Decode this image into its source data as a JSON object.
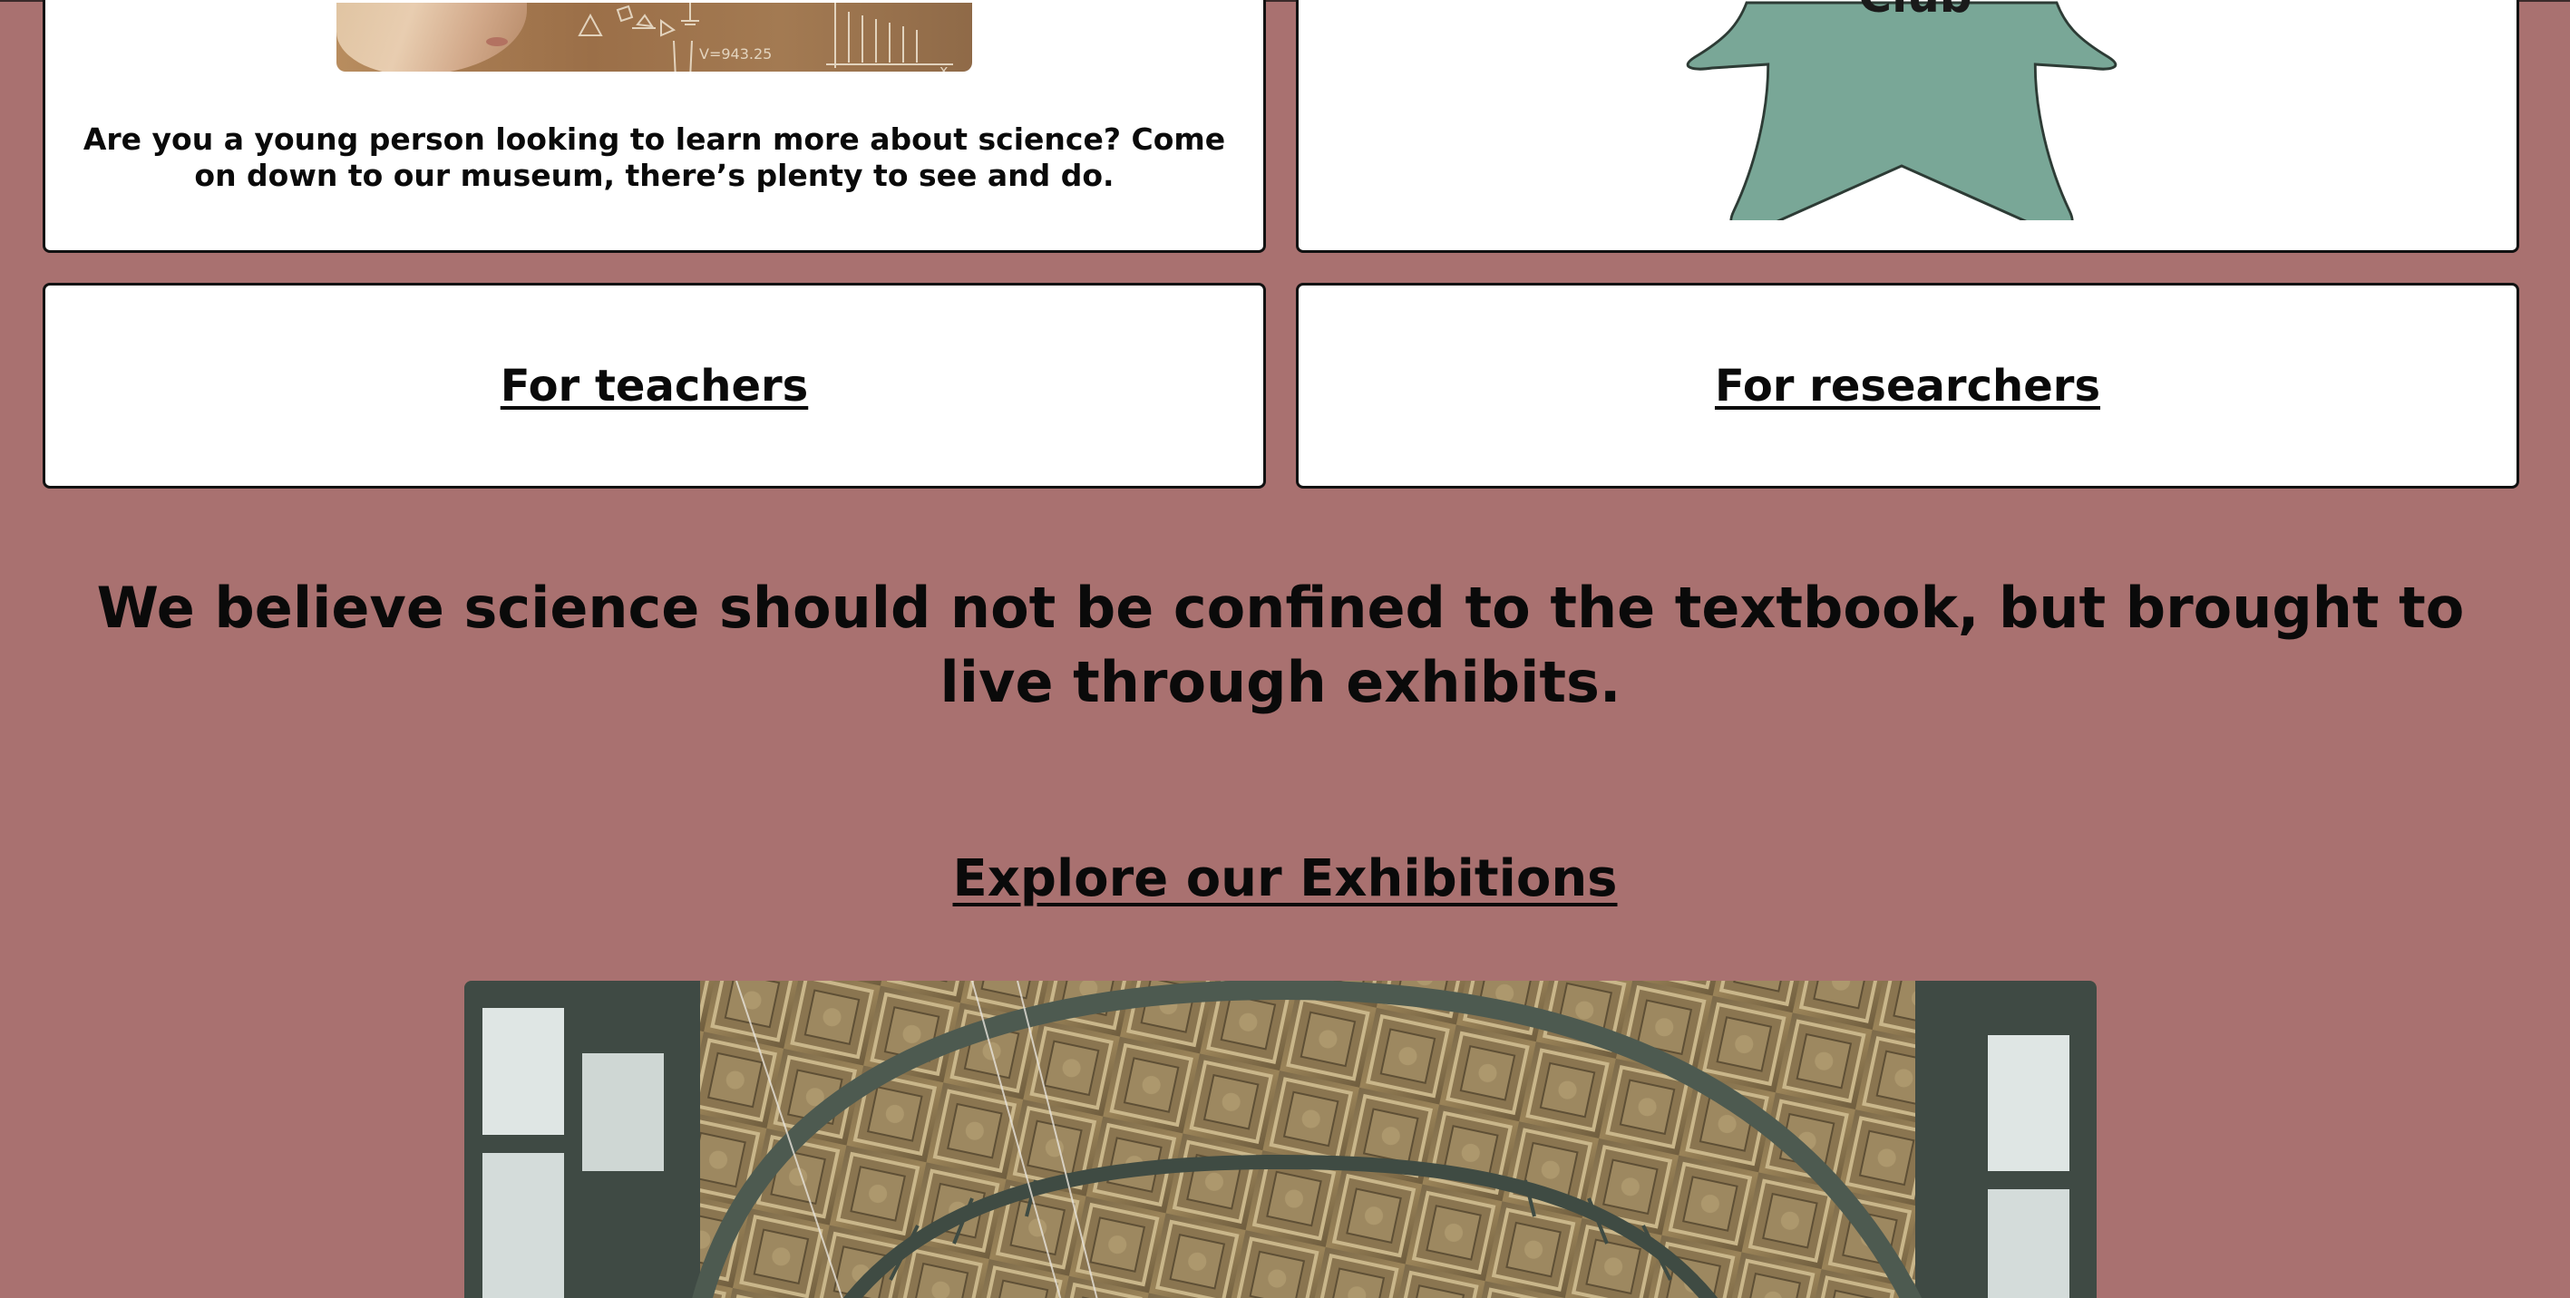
{
  "cards": {
    "young": {
      "text": "Are you a young person looking to learn more about science? Come on down to our museum, there’s plenty to see and do.",
      "photo_alt": "young-person-photo"
    },
    "club": {
      "star_text": "Club",
      "star_color": "#79a797"
    },
    "teachers": {
      "link_label": "For teachers"
    },
    "researchers": {
      "link_label": "For researchers"
    }
  },
  "belief_statement": "We believe science should not be confined to the textbook, but brought to live through exhibits.",
  "explore_link": "Explore our Exhibitions",
  "colors": {
    "page_background": "#a97170",
    "card_background": "#ffffff",
    "text": "#0a0a0a"
  }
}
